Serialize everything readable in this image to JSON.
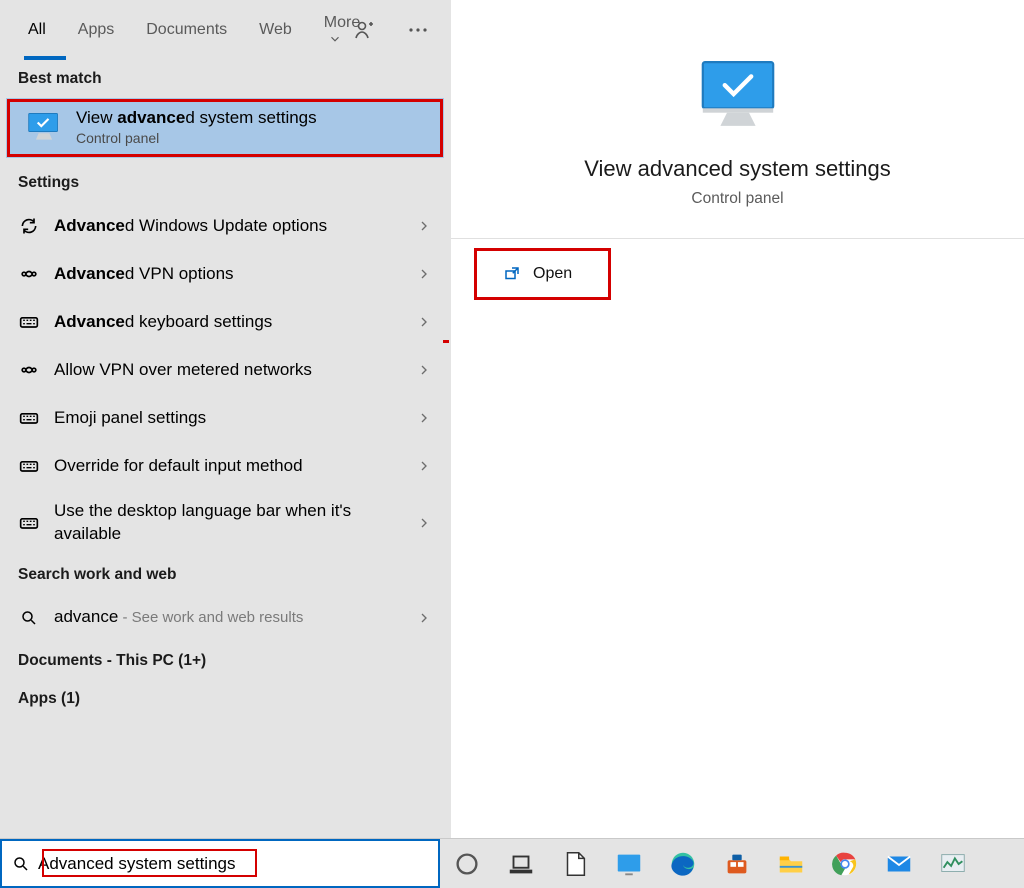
{
  "tabs": {
    "all": "All",
    "apps": "Apps",
    "documents": "Documents",
    "web": "Web",
    "more": "More"
  },
  "sections": {
    "best_match": "Best match",
    "settings": "Settings",
    "search_work_web": "Search work and web",
    "documents_pc": "Documents - This PC (1+)",
    "apps_count": "Apps (1)"
  },
  "best_match_item": {
    "title_pre": "View ",
    "title_bold": "advance",
    "title_post": "d system settings",
    "subtitle": "Control panel"
  },
  "settings_rows": [
    {
      "icon": "refresh",
      "bold": "Advance",
      "rest": "d Windows Update options"
    },
    {
      "icon": "vpn",
      "bold": "Advance",
      "rest": "d VPN options"
    },
    {
      "icon": "keyboard",
      "bold": "Advance",
      "rest": "d keyboard settings"
    },
    {
      "icon": "vpn",
      "bold": "",
      "rest": "Allow VPN over metered networks"
    },
    {
      "icon": "keyboard",
      "bold": "",
      "rest": "Emoji panel settings"
    },
    {
      "icon": "keyboard",
      "bold": "",
      "rest": "Override for default input method"
    },
    {
      "icon": "keyboard",
      "bold": "",
      "rest": "Use the desktop language bar when it's available"
    }
  ],
  "web_row": {
    "query": "advance",
    "hint": " - See work and web results"
  },
  "detail": {
    "title": "View advanced system settings",
    "subtitle": "Control panel",
    "open": "Open"
  },
  "search": {
    "value": "Advanced system settings"
  },
  "taskbar_icons": [
    "cortana-icon",
    "taskview-icon",
    "libreoffice-icon",
    "background-icon",
    "edge-icon",
    "store-icon",
    "explorer-icon",
    "chrome-icon",
    "mail-icon",
    "taskmgr-icon"
  ]
}
